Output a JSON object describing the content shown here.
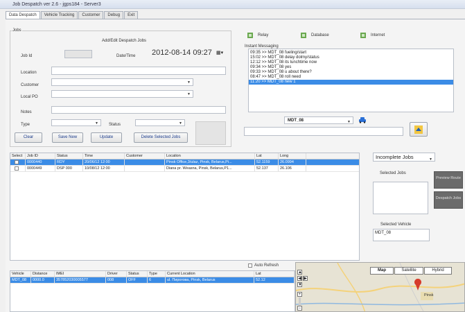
{
  "window": {
    "title": "Job Despatch ver 2.6 - jgps184 - Server3"
  },
  "tabs": [
    {
      "label": "Data Despatch",
      "active": true
    },
    {
      "label": "Vehicle Tracking",
      "active": false
    },
    {
      "label": "Customer",
      "active": false
    },
    {
      "label": "Debug",
      "active": false
    },
    {
      "label": "Exit",
      "active": false
    }
  ],
  "jobs_form": {
    "group_label": "Jobs",
    "heading": "Add/Edit Despatch Jobs",
    "job_id_label": "Job Id",
    "date_time_label": "Date/Time",
    "date_time_value": "2012-08-14 09:27",
    "location_label": "Location",
    "customer_label": "Customer",
    "local_po_label": "Local PO",
    "notes_label": "Notes",
    "type_label": "Type",
    "status_label": "Status",
    "buttons": {
      "clear": "Clear",
      "save_new": "Save New",
      "update": "Update",
      "delete_selected": "Delete Selected Jobs"
    }
  },
  "toolbar": {
    "relay": "Relay",
    "database": "Database",
    "internet": "Internet"
  },
  "messaging": {
    "label": "Instant Messaging",
    "lines": [
      "09:35 >> MDT_08 fueling/start",
      "15:02 >> MDT_08 delay dolmy/status",
      "12:12 >> MDT_08 its lunchtime now",
      "09:34 >> MDT_08 yes",
      "09:33 >> MDT_08 u about there?",
      "08:47 >> MDT_08 roll need",
      "11:20 >> MDT_08 new 1"
    ],
    "selected_index": 6,
    "vehicle_select": "MDT_08"
  },
  "jobs_grid": {
    "headers": [
      "Select",
      "Job ID",
      "Status",
      "Time",
      "Customer",
      "Location",
      "Lat",
      "Long"
    ],
    "rows": [
      {
        "job_id": "0000440",
        "status": "RDY",
        "time": "20/06/12 12:00",
        "customer": "",
        "location": "Pinsk Office,3/ulaz, Pinsk, Belarus,Pi...",
        "lat": "52.1159",
        "long": "26.0994",
        "selected": true
      },
      {
        "job_id": "0000449",
        "status": "DSP 000",
        "time": "10/08/12 12:00",
        "customer": "",
        "location": "Diana pr. Weasna, Pinsk, Belarus,P1...",
        "lat": "52.137",
        "long": "26.106",
        "selected": false
      }
    ]
  },
  "right_panel": {
    "filter_select": "Incomplete Jobs",
    "selected_jobs_label": "Selected Jobs",
    "preview_route": "Preview Route",
    "despatch_jobs": "Despatch Jobs",
    "selected_vehicle_label": "Selected Vehicle",
    "selected_vehicle_value": "MDT_08"
  },
  "vehicle_grid": {
    "auto_refresh_label": "Auto Refresh",
    "headers": [
      "Vehicle",
      "Distance",
      "IMEI",
      "Driver",
      "Status",
      "Type",
      "Current Location",
      "Lat"
    ],
    "rows": [
      {
        "vehicle": "MDT_08",
        "distance": "0000.0",
        "imei": "357852030005577",
        "driver": "008",
        "status": "OFF",
        "type": "6",
        "location": "ul. Пирогова, Pinsk, Belarus",
        "lat": "52.12"
      }
    ]
  },
  "map": {
    "buttons": {
      "map": "Map",
      "satellite": "Satellite",
      "hybrid": "Hybrid"
    },
    "labels": [
      "Pinsk"
    ]
  },
  "colors": {
    "accent": "#3b8ce6",
    "titlebar": "#d6dfee"
  }
}
